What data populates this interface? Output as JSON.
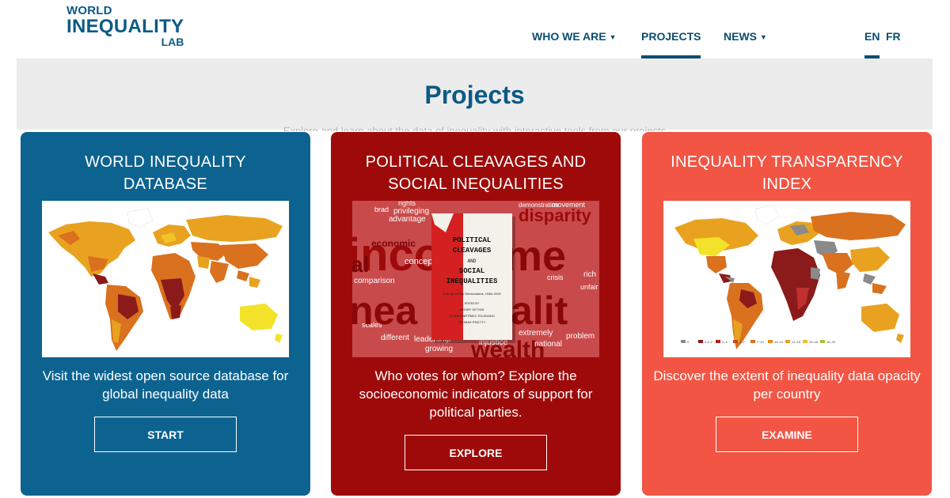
{
  "logo": {
    "line1": "WORLD",
    "line2": "INEQUALITY",
    "line3": "LAB"
  },
  "nav": {
    "who_we_are": "WHO WE ARE",
    "projects": "PROJECTS",
    "news": "NEWS",
    "lang_en": "EN",
    "lang_fr": "FR"
  },
  "banner": {
    "title": "Projects",
    "subtext": "Explore and learn about the data of inequality with interactive tools from our projects"
  },
  "cards": [
    {
      "title": "WORLD INEQUALITY DATABASE",
      "description": "Visit the widest open source database for global inequality data",
      "button": "START"
    },
    {
      "title": "POLITICAL CLEAVAGES AND SOCIAL INEQUALITIES",
      "description": "Who votes for whom? Explore the socioeconomic indicators of support for political parties.",
      "button": "EXPLORE",
      "book": {
        "title": "POLITICAL CLEAVAGES AND SOCIAL INEQUALITIES",
        "subtitle": "A Study of Fifty Democracies, 1948–2020",
        "edited_by": "EDITED BY",
        "editors": [
          "AMORY GETHIN",
          "CLARA MARTÍNEZ-TOLEDANO",
          "THOMAS PIKETTY"
        ]
      },
      "words": [
        "income",
        "wealth",
        "disparity",
        "economic",
        "concept",
        "comparison",
        "problem",
        "national",
        "extremely",
        "growing",
        "different",
        "leadership",
        "advantage",
        "privileging",
        "rights",
        "brad",
        "crisis",
        "unfair",
        "injustice",
        "demonstration",
        "movement",
        "scales",
        "partner",
        "rich",
        "al"
      ]
    },
    {
      "title": "INEQUALITY TRANSPARENCY INDEX",
      "description": "Discover the extent of inequality data opacity per country",
      "button": "EXAMINE",
      "legend": [
        "0",
        "0.5–2",
        "2–4",
        "4–7",
        "7–10",
        "10–12",
        "12–15",
        "15–18",
        "18–20"
      ]
    }
  ],
  "colors": {
    "brand_blue": "#0b5a85",
    "card1": "#0c6390",
    "card2": "#9e0a0a",
    "card3": "#f25544",
    "map_dark": "#8b1a1a",
    "map_orange": "#d9711f",
    "map_amber": "#e9a21f",
    "map_yellow": "#f2e32a"
  }
}
